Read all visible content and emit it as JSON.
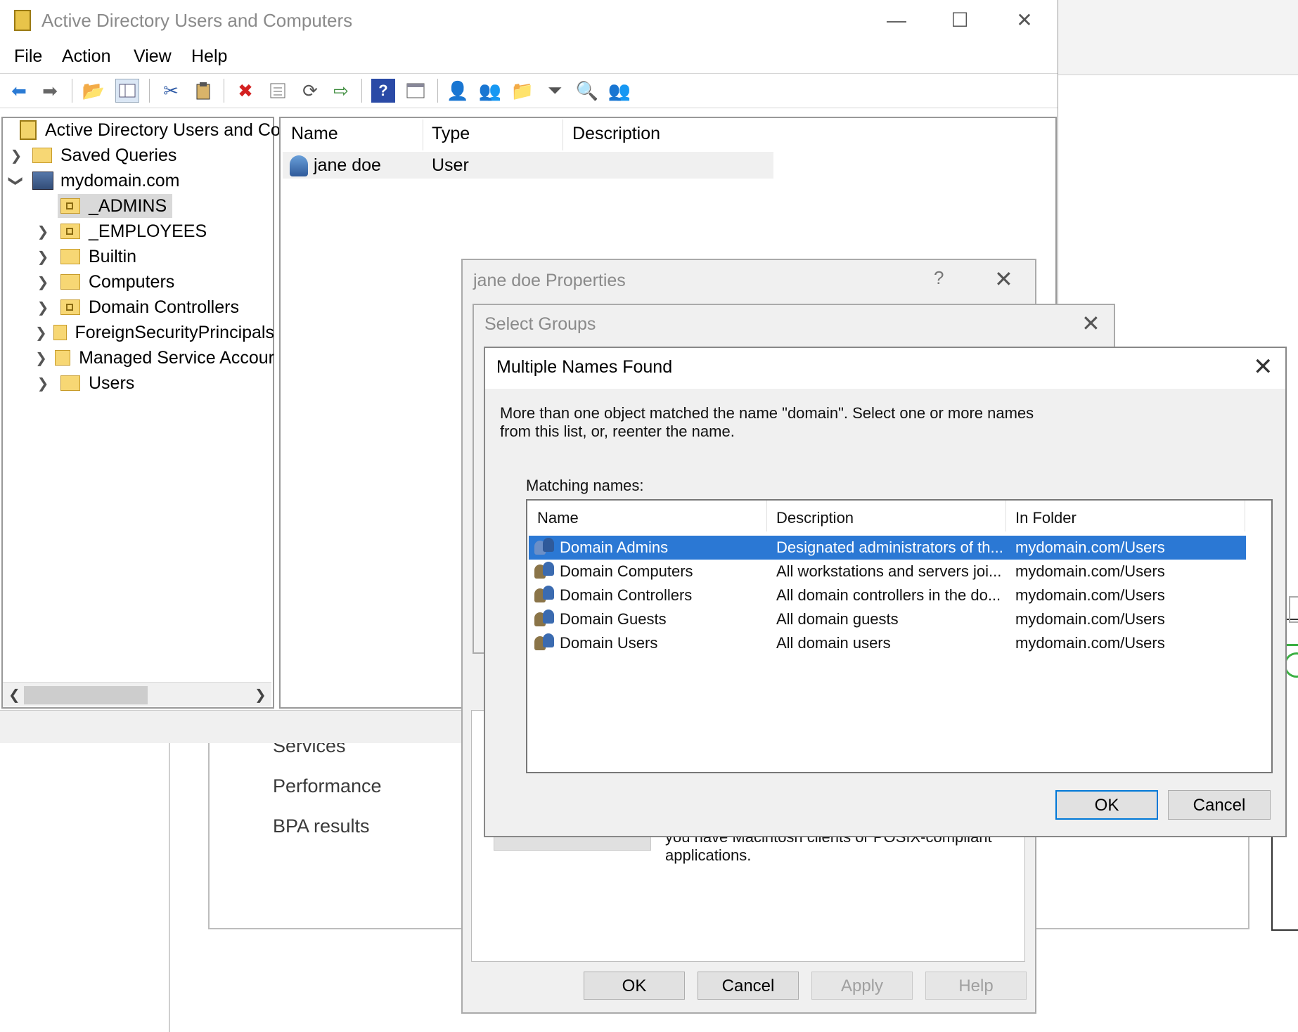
{
  "background": {
    "links": [
      "Services",
      "Performance",
      "BPA results"
    ]
  },
  "aduc": {
    "title": "Active Directory Users and Computers",
    "window_buttons": {
      "minimize": "—",
      "maximize": "☐",
      "close": "✕"
    },
    "menu": [
      "File",
      "Action",
      "View",
      "Help"
    ],
    "tree": {
      "root": "Active Directory Users and Com",
      "saved_queries": "Saved Queries",
      "domain": "mydomain.com",
      "children": [
        "_ADMINS",
        "_EMPLOYEES",
        "Builtin",
        "Computers",
        "Domain Controllers",
        "ForeignSecurityPrincipals",
        "Managed Service Accour",
        "Users"
      ]
    },
    "list": {
      "columns": [
        "Name",
        "Type",
        "Description"
      ],
      "rows": [
        {
          "name": "jane doe",
          "type": "User",
          "description": ""
        }
      ]
    }
  },
  "properties": {
    "title": "jane doe Properties",
    "help": "?",
    "posix_text": "you have Macintosh clients or POSIX-compliant applications.",
    "buttons": [
      "OK",
      "Cancel",
      "Apply",
      "Help"
    ]
  },
  "select_groups": {
    "title": "Select Groups"
  },
  "multiple_names": {
    "title": "Multiple Names Found",
    "message": "More than one object matched the name \"domain\". Select one or more names from this list, or, reenter the name.",
    "matching_label": "Matching names:",
    "columns": [
      "Name",
      "Description",
      "In Folder"
    ],
    "rows": [
      {
        "name": "Domain Admins",
        "description": "Designated administrators of th...",
        "folder": "mydomain.com/Users",
        "selected": true
      },
      {
        "name": "Domain Computers",
        "description": "All workstations and servers joi...",
        "folder": "mydomain.com/Users",
        "selected": false
      },
      {
        "name": "Domain Controllers",
        "description": "All domain controllers in the do...",
        "folder": "mydomain.com/Users",
        "selected": false
      },
      {
        "name": "Domain Guests",
        "description": "All domain guests",
        "folder": "mydomain.com/Users",
        "selected": false
      },
      {
        "name": "Domain Users",
        "description": "All domain users",
        "folder": "mydomain.com/Users",
        "selected": false
      }
    ],
    "ok": "OK",
    "cancel": "Cancel"
  },
  "colors": {
    "selection": "#2b78d4",
    "default_button_border": "#0078d7"
  },
  "icons": {
    "toolbar": [
      "back-icon",
      "forward-icon",
      "up-folder-icon",
      "show-tree-icon",
      "cut-icon",
      "paste-icon",
      "delete-icon",
      "properties-icon",
      "refresh-icon",
      "export-icon",
      "help-icon",
      "console-icon",
      "new-user-icon",
      "new-group-icon",
      "new-ou-icon",
      "filter-icon",
      "find-icon",
      "add-to-group-icon"
    ]
  }
}
